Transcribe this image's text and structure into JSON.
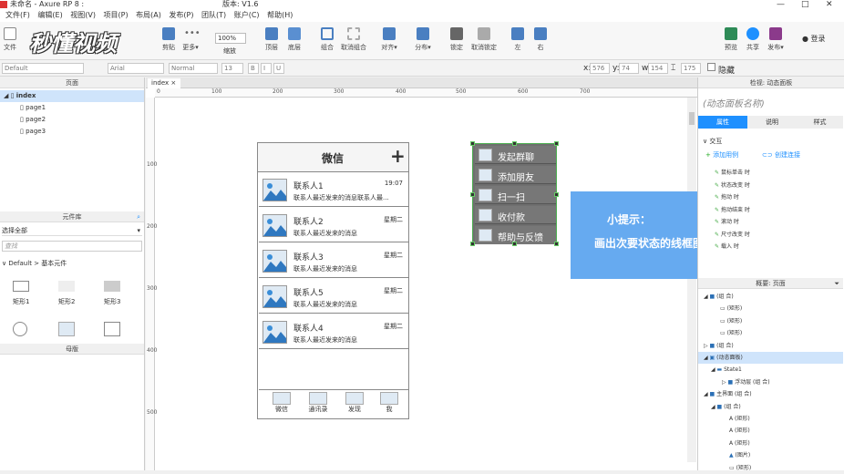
{
  "window": {
    "title": "未命名 - Axure RP 8 :",
    "version": "版本: V1.6"
  },
  "menu": [
    "文件(F)",
    "编辑(E)",
    "视图(V)",
    "项目(P)",
    "布局(A)",
    "发布(P)",
    "团队(T)",
    "账户(C)",
    "帮助(H)"
  ],
  "toolbar": {
    "file": "文件",
    "clipboard": "剪贴",
    "more": "更多▾",
    "zoom": "100%",
    "zoom_label": "缩放",
    "top": "顶层",
    "bottom": "底层",
    "group": "组合",
    "ungroup": "取消组合",
    "align": "对齐▾",
    "distribute": "分布▾",
    "lock": "锁定",
    "unlock": "取消锁定",
    "left": "左",
    "right": "右",
    "preview": "预览",
    "share": "共享",
    "publish": "发布▾",
    "login": "登录"
  },
  "logo": "秒懂视频",
  "formatbar": {
    "style": "Default",
    "font": "Arial",
    "weight": "Normal",
    "size": "13",
    "x_label": "x:",
    "x": "576",
    "y_label": "y:",
    "y": "74",
    "w_label": "w:",
    "w": "154",
    "h": "175",
    "hidden": "隐藏"
  },
  "pages": {
    "title": "页面",
    "items": [
      "index",
      "page1",
      "page2",
      "page3"
    ]
  },
  "library": {
    "title": "元件库",
    "select": "选择全部",
    "search_placeholder": "查找",
    "group": "Default > 基本元件",
    "shapes": [
      "矩形1",
      "矩形2",
      "矩形3"
    ]
  },
  "masters": {
    "title": "母版"
  },
  "tab": {
    "name": "index"
  },
  "ruler": {
    "h": [
      "0",
      "100",
      "200",
      "300",
      "400",
      "500",
      "600",
      "700"
    ],
    "v": [
      "100",
      "200",
      "300",
      "400",
      "500"
    ]
  },
  "phone": {
    "title": "微信",
    "plus": "+",
    "contacts": [
      {
        "name": "联系人1",
        "msg": "联系人最近发来的消息联系人最...",
        "time": "19:07"
      },
      {
        "name": "联系人2",
        "msg": "联系人最近发来的消息",
        "time": "星期二"
      },
      {
        "name": "联系人3",
        "msg": "联系人最近发来的消息",
        "time": "星期二"
      },
      {
        "name": "联系人5",
        "msg": "联系人最近发来的消息",
        "time": "星期二"
      },
      {
        "name": "联系人4",
        "msg": "联系人最近发来的消息",
        "time": "星期二"
      }
    ],
    "tabs": [
      "微信",
      "通讯录",
      "发现",
      "我"
    ]
  },
  "popup": {
    "items": [
      "发起群聊",
      "添加朋友",
      "扫一扫",
      "收付款",
      "帮助与反馈"
    ]
  },
  "tip": {
    "title": "小提示：",
    "body": "画出次要状态的线框图"
  },
  "inspector": {
    "header": "检视: 动态面板",
    "name": "(动态面板名称)",
    "tabs": [
      "属性",
      "说明",
      "样式"
    ],
    "section": "交互",
    "add_case": "添加用例",
    "create_link": "创建连接",
    "events": [
      "鼠标单击 时",
      "状态改变 时",
      "拖动 时",
      "拖动结束 时",
      "滚动 时",
      "尺寸改变 时",
      "载入 时"
    ]
  },
  "outline": {
    "title": "概要: 页面",
    "items": [
      "(组 合)",
      "(矩形)",
      "(矩形)",
      "(矩形)",
      "(组 合)",
      "(动态面板)",
      "State1",
      "浮动层 (组 合)",
      "主界面 (组 合)",
      "(组 合)",
      "(矩形)",
      "(矩形)",
      "(矩形)",
      "(图片)",
      "(矩形)"
    ]
  },
  "colors": {
    "accent": "#1e90ff",
    "tip": "#66aaf0",
    "popup": "#6f6f6f",
    "select": "#4caf50"
  }
}
